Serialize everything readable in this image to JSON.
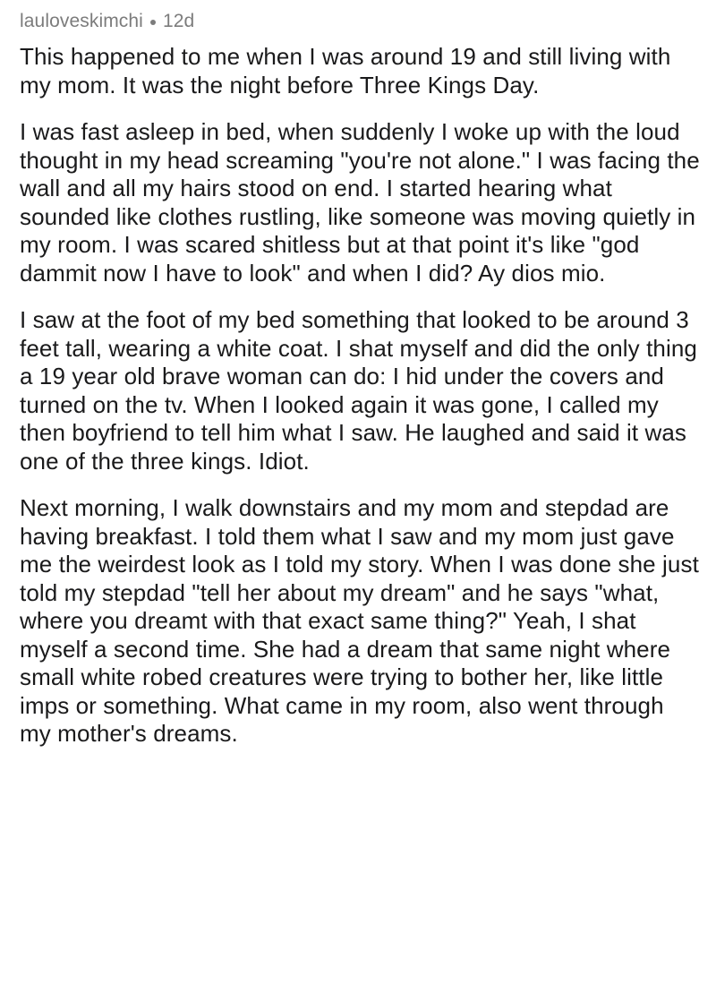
{
  "comment": {
    "author": "lauloveskimchi",
    "age": "12d",
    "paragraphs": [
      "This happened to me when I was around 19 and still living with my mom. It was the night before Three Kings Day.",
      "I was fast asleep in bed, when suddenly I woke up with the loud thought in my head screaming \"you're not alone.\" I was facing the wall and all my hairs stood on end. I started hearing what sounded like clothes rustling, like someone was moving quietly in my room. I was scared shitless but at that point it's like \"god dammit now I have to look\" and when I did? Ay dios mio.",
      "I saw at the foot of my bed something that looked to be around 3 feet tall, wearing a white coat. I shat myself and did the only thing a 19 year old brave woman can do: I hid under the covers and turned on the tv. When I looked again it was gone, I called my then boyfriend to tell him what I saw. He laughed and said it was one of the three kings. Idiot.",
      "Next morning, I walk downstairs and my mom and stepdad are having breakfast. I told them what I saw and my mom just gave me the weirdest look as I told my story. When I was done she just told my stepdad \"tell her about my dream\" and he says \"what, where you dreamt with that exact same thing?\" Yeah, I shat myself a second time. She had a dream that same night where small white robed creatures were trying to bother her, like little imps or something. What came in my room, also went through my mother's dreams."
    ]
  }
}
